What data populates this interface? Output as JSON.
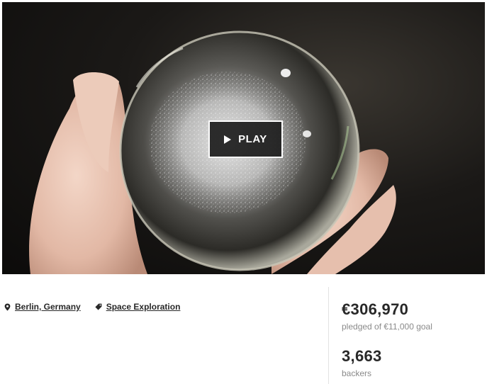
{
  "video": {
    "play_label": "PLAY",
    "icons": {
      "play": "play-triangle-icon"
    }
  },
  "project_meta": {
    "location": {
      "label": "Berlin, Germany",
      "icon": "map-pin-icon"
    },
    "category": {
      "label": "Space Exploration",
      "icon": "tag-icon"
    }
  },
  "stats": {
    "pledged_amount": "€306,970",
    "pledged_caption": "pledged of €11,000 goal",
    "backers_count": "3,663",
    "backers_caption": "backers"
  },
  "colors": {
    "text_primary": "#282828",
    "text_secondary": "#8a8a8a",
    "divider": "#e2e2e2",
    "video_background": "#0c0b0a"
  }
}
